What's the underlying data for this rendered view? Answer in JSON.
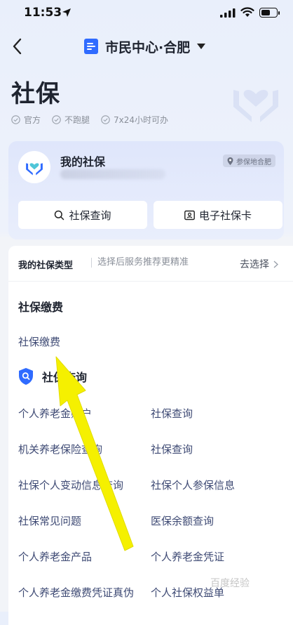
{
  "status": {
    "time": "11:53"
  },
  "nav": {
    "title": "市民中心·合肥"
  },
  "page": {
    "title": "社保",
    "tags": [
      "官方",
      "不跑腿",
      "7x24小时可办"
    ]
  },
  "card": {
    "title": "我的社保",
    "region": "参保地合肥",
    "buttons": {
      "query": "社保查询",
      "ecard": "电子社保卡"
    }
  },
  "type_row": {
    "label": "我的社保类型",
    "hint": "选择后服务推荐更精准",
    "action": "去选择"
  },
  "payment": {
    "title": "社保缴费",
    "link": "社保缴费"
  },
  "query": {
    "title": "社保查询",
    "items": [
      "个人养老金账户",
      "社保查询",
      "机关养老保险查询",
      "社保查询",
      "社保个人变动信息查询",
      "社保个人参保信息",
      "社保常见问题",
      "医保余额查询",
      "个人养老金产品",
      "个人养老金凭证",
      "个人养老金缴费凭证真伪",
      "个人社保权益单"
    ]
  },
  "colors": {
    "accent": "#2f6bff",
    "annotation_arrow": "#f5f000"
  },
  "watermark": "百度经验"
}
